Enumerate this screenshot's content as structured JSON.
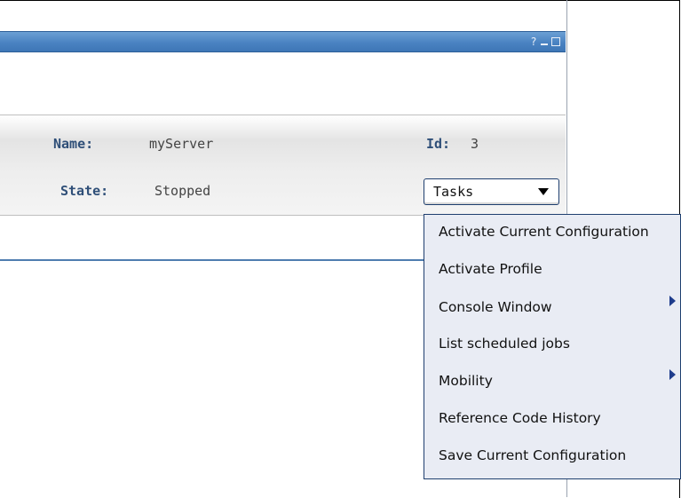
{
  "titlebar": {
    "help_label": "?"
  },
  "server": {
    "name_label": "Name:",
    "name_value": "myServer",
    "id_label": "Id:",
    "id_value": "3",
    "state_label": "State:",
    "state_value": "Stopped"
  },
  "tasks": {
    "label": "Tasks",
    "menu_items": [
      {
        "label": "Activate Current Configuration",
        "has_submenu": false
      },
      {
        "label": "Activate Profile",
        "has_submenu": false
      },
      {
        "label": "Console Window",
        "has_submenu": true
      },
      {
        "label": "List scheduled jobs",
        "has_submenu": false
      },
      {
        "label": "Mobility",
        "has_submenu": true
      },
      {
        "label": "Reference Code History",
        "has_submenu": false
      },
      {
        "label": "Save Current Configuration",
        "has_submenu": false
      }
    ]
  },
  "colors": {
    "titlebar": "#4a83c2",
    "label_text": "#2f4f78",
    "menu_bg": "#e9ecf4",
    "submenu_arrow": "#1e3c8c"
  }
}
